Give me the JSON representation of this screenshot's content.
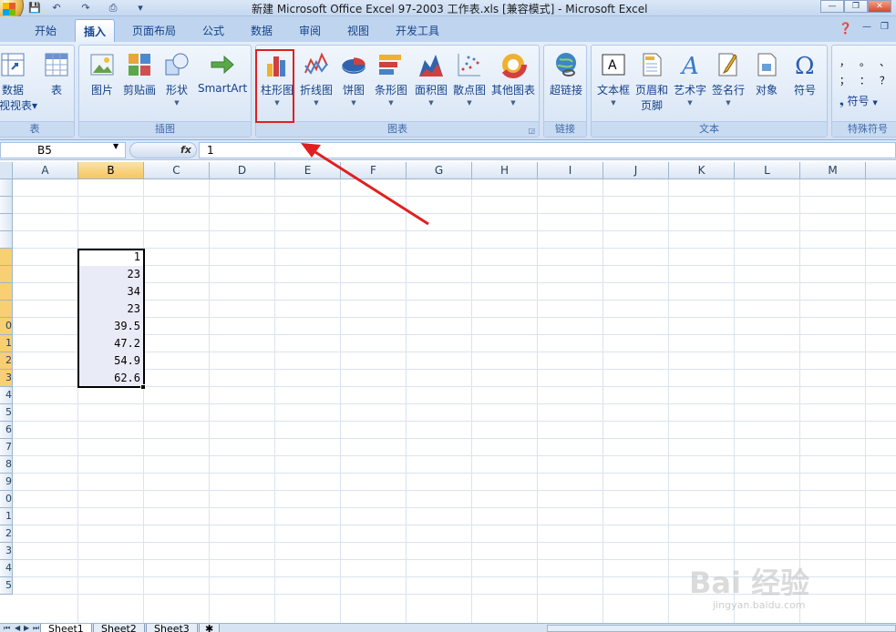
{
  "window": {
    "title": "新建 Microsoft Office Excel 97-2003 工作表.xls  [兼容模式] - Microsoft Excel",
    "controls": [
      "—",
      "❐",
      "✕"
    ]
  },
  "quick_access": [
    "💾",
    "↶",
    "↷",
    "⎙",
    "▾"
  ],
  "tabs": [
    "开始",
    "插入",
    "页面布局",
    "公式",
    "数据",
    "审阅",
    "视图",
    "开发工具"
  ],
  "active_tab": "插入",
  "ribbon": {
    "groups": [
      {
        "label": "表",
        "buttons": [
          "数据\n视视表▾",
          "表"
        ]
      },
      {
        "label": "插图",
        "buttons": [
          "图片",
          "剪贴画",
          "形状",
          "SmartArt"
        ]
      },
      {
        "label": "图表",
        "buttons": [
          "柱形图",
          "折线图",
          "饼图",
          "条形图",
          "面积图",
          "散点图",
          "其他图表"
        ]
      },
      {
        "label": "链接",
        "buttons": [
          "超链接"
        ]
      },
      {
        "label": "文本",
        "buttons": [
          "文本框",
          "页眉和\n页脚",
          "艺术字",
          "签名行",
          "对象",
          "符号"
        ]
      },
      {
        "label": "特殊符号",
        "buttons": [
          "符号"
        ]
      }
    ],
    "table_label1": "数据",
    "table_label2": "视视表▾",
    "header_footer1": "页眉和",
    "header_footer2": "页脚",
    "special_symbols": [
      "，",
      "。",
      "、",
      "；",
      "：",
      "？"
    ]
  },
  "formula_bar": {
    "name_box": "B5",
    "fx": "fx",
    "value": "1"
  },
  "columns": [
    "A",
    "B",
    "C",
    "D",
    "E",
    "F",
    "G",
    "H",
    "I",
    "J",
    "K",
    "L",
    "M"
  ],
  "rows": [
    "",
    "",
    "",
    "",
    "",
    "",
    "",
    "",
    "0",
    "1",
    "2",
    "3",
    "4",
    "5",
    "6",
    "7",
    "8",
    "9",
    "0",
    "1",
    "2",
    "3",
    "4",
    "5"
  ],
  "cells_b": [
    "1",
    "23",
    "34",
    "23",
    "39.5",
    "47.2",
    "54.9",
    "62.6"
  ],
  "sheets": [
    "Sheet1",
    "Sheet2",
    "Sheet3"
  ],
  "watermark": {
    "text": "Bai 经验",
    "sub": "jingyan.baidu.com"
  },
  "colors": {
    "accent": "#15428b",
    "highlight": "#e02020"
  }
}
